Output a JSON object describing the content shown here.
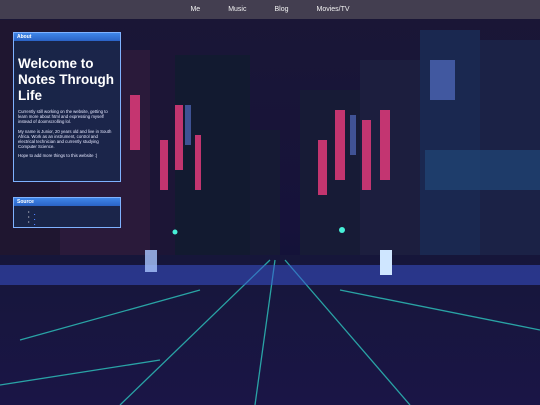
{
  "nav": {
    "items": [
      "Me",
      "Music",
      "Blog",
      "Movies/TV"
    ]
  },
  "about": {
    "header": "About",
    "title": "Welcome to Notes Through Life",
    "paragraphs": [
      "Currently still working on the website, getting to learn more about html and expressing myself instead of doomscrolling lol.",
      "My name is Junior, 20 years old and live in South Africa. Work as an instrument, control and electrical technician and currently studying Computer Science.",
      "Hope to add more things to this website :)"
    ]
  },
  "source": {
    "header": "Source",
    "links": [
      "",
      "",
      ""
    ]
  },
  "colors": {
    "panel_border": "#7fb2ff",
    "panel_header": "#3f86e8",
    "nav_bg": "#464252"
  }
}
